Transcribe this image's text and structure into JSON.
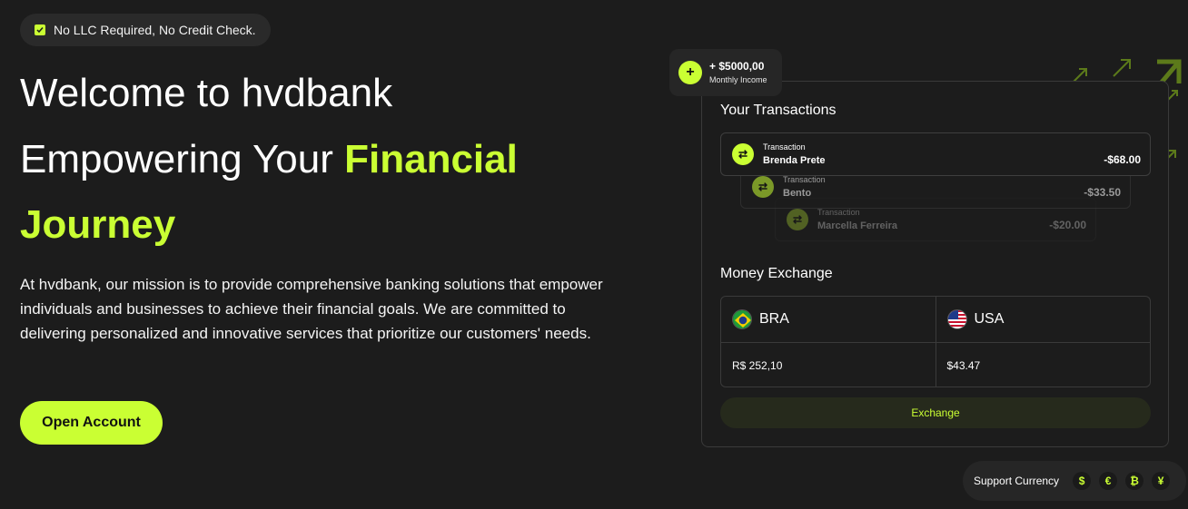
{
  "badge": {
    "text": "No LLC Required, No Credit Check."
  },
  "hero": {
    "line1": "Welcome to hvdbank",
    "line2_plain": "Empowering Your ",
    "line2_accent": "Financial",
    "line3": "Journey",
    "description": "At hvdbank, our mission is to provide comprehensive banking solutions that empower individuals and businesses to achieve their financial goals. We are committed to delivering personalized and innovative services that prioritize our customers' needs.",
    "cta_label": "Open Account"
  },
  "income": {
    "amount": "+ $5000,00",
    "label": "Monthly Income",
    "icon": "plus-icon"
  },
  "transactions": {
    "title": "Your Transactions",
    "items": [
      {
        "kind": "Transaction",
        "name": "Brenda Prete",
        "amount": "-$68.00"
      },
      {
        "kind": "Transaction",
        "name": "Bento",
        "amount": "-$33.50"
      },
      {
        "kind": "Transaction",
        "name": "Marcella Ferreira",
        "amount": "-$20.00"
      }
    ]
  },
  "exchange": {
    "title": "Money Exchange",
    "from": {
      "currency": "BRA",
      "value": "R$ 252,10",
      "icon": "brazil-flag-icon"
    },
    "to": {
      "currency": "USA",
      "value": "$43.47",
      "icon": "usa-flag-icon"
    },
    "button_label": "Exchange"
  },
  "support": {
    "label": "Support Currency",
    "coins": [
      "$",
      "€",
      "₿",
      "¥"
    ]
  },
  "colors": {
    "accent": "#caff33",
    "background": "#1c1c1c",
    "surface": "#262626"
  }
}
